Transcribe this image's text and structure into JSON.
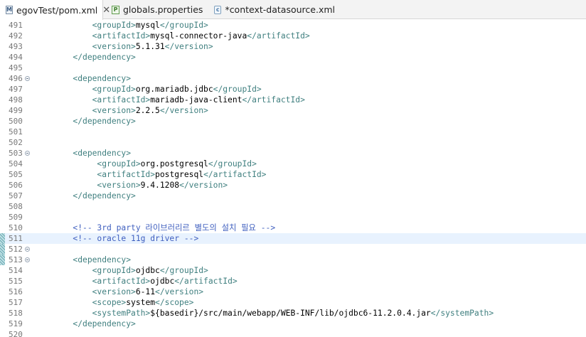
{
  "tabs": [
    {
      "label": "egovTest/pom.xml",
      "icon": "maven-xml-file-icon",
      "active": true
    },
    {
      "label": "globals.properties",
      "icon": "properties-file-icon",
      "active": false
    },
    {
      "label": "*context-datasource.xml",
      "icon": "xml-file-icon",
      "active": false
    }
  ],
  "colors": {
    "tag": "#3f7f7f",
    "text": "#000000",
    "comment": "#3f5fbf",
    "current_line": "#e8f2fe"
  },
  "lines": [
    {
      "num": "491",
      "parts": [
        [
          "t",
          "            <groupId>"
        ],
        [
          "x",
          "mysql"
        ],
        [
          "t",
          "</groupId>"
        ]
      ]
    },
    {
      "num": "492",
      "parts": [
        [
          "t",
          "            <artifactId>"
        ],
        [
          "x",
          "mysql-connector-java"
        ],
        [
          "t",
          "</artifactId>"
        ]
      ]
    },
    {
      "num": "493",
      "parts": [
        [
          "t",
          "            <version>"
        ],
        [
          "x",
          "5.1.31"
        ],
        [
          "t",
          "</version>"
        ]
      ]
    },
    {
      "num": "494",
      "parts": [
        [
          "t",
          "        </dependency>"
        ]
      ]
    },
    {
      "num": "495",
      "parts": []
    },
    {
      "num": "496",
      "fold": true,
      "parts": [
        [
          "t",
          "        <dependency>"
        ]
      ]
    },
    {
      "num": "497",
      "parts": [
        [
          "t",
          "            <groupId>"
        ],
        [
          "x",
          "org.mariadb.jdbc"
        ],
        [
          "t",
          "</groupId>"
        ]
      ]
    },
    {
      "num": "498",
      "parts": [
        [
          "t",
          "            <artifactId>"
        ],
        [
          "x",
          "mariadb-java-client"
        ],
        [
          "t",
          "</artifactId>"
        ]
      ]
    },
    {
      "num": "499",
      "parts": [
        [
          "t",
          "            <version>"
        ],
        [
          "x",
          "2.2.5"
        ],
        [
          "t",
          "</version>"
        ]
      ]
    },
    {
      "num": "500",
      "parts": [
        [
          "t",
          "        </dependency>"
        ]
      ]
    },
    {
      "num": "501",
      "parts": []
    },
    {
      "num": "502",
      "parts": []
    },
    {
      "num": "503",
      "fold": true,
      "parts": [
        [
          "t",
          "        <dependency>"
        ]
      ]
    },
    {
      "num": "504",
      "parts": [
        [
          "t",
          "             <groupId>"
        ],
        [
          "x",
          "org.postgresql"
        ],
        [
          "t",
          "</groupId>"
        ]
      ]
    },
    {
      "num": "505",
      "parts": [
        [
          "t",
          "             <artifactId>"
        ],
        [
          "x",
          "postgresql"
        ],
        [
          "t",
          "</artifactId>"
        ]
      ]
    },
    {
      "num": "506",
      "parts": [
        [
          "t",
          "             <version>"
        ],
        [
          "x",
          "9.4.1208"
        ],
        [
          "t",
          "</version>"
        ]
      ]
    },
    {
      "num": "507",
      "parts": [
        [
          "t",
          "        </dependency>"
        ]
      ]
    },
    {
      "num": "508",
      "parts": []
    },
    {
      "num": "509",
      "parts": []
    },
    {
      "num": "510",
      "parts": [
        [
          "c",
          "        <!-- 3rd party 라이브러리르 별도의 설치 필요 -->"
        ]
      ]
    },
    {
      "num": "511",
      "marker": true,
      "current": true,
      "parts": [
        [
          "c",
          "        <!-- oracle 11g driver -->"
        ]
      ]
    },
    {
      "num": "512",
      "marker": true,
      "fold": true,
      "parts": []
    },
    {
      "num": "513",
      "marker": true,
      "fold": true,
      "parts": [
        [
          "t",
          "        <dependency>"
        ]
      ]
    },
    {
      "num": "514",
      "parts": [
        [
          "t",
          "            <groupId>"
        ],
        [
          "x",
          "ojdbc"
        ],
        [
          "t",
          "</groupId>"
        ]
      ]
    },
    {
      "num": "515",
      "parts": [
        [
          "t",
          "            <artifactId>"
        ],
        [
          "x",
          "ojdbc"
        ],
        [
          "t",
          "</artifactId>"
        ]
      ]
    },
    {
      "num": "516",
      "parts": [
        [
          "t",
          "            <version>"
        ],
        [
          "x",
          "6-11"
        ],
        [
          "t",
          "</version>"
        ]
      ]
    },
    {
      "num": "517",
      "parts": [
        [
          "t",
          "            <scope>"
        ],
        [
          "x",
          "system"
        ],
        [
          "t",
          "</scope>"
        ]
      ]
    },
    {
      "num": "518",
      "parts": [
        [
          "t",
          "            <systemPath>"
        ],
        [
          "x",
          "${basedir}/src/main/webapp/WEB-INF/lib/ojdbc6-11.2.0.4.jar"
        ],
        [
          "t",
          "</systemPath>"
        ]
      ]
    },
    {
      "num": "519",
      "parts": [
        [
          "t",
          "        </dependency>"
        ]
      ]
    },
    {
      "num": "520",
      "parts": []
    }
  ]
}
